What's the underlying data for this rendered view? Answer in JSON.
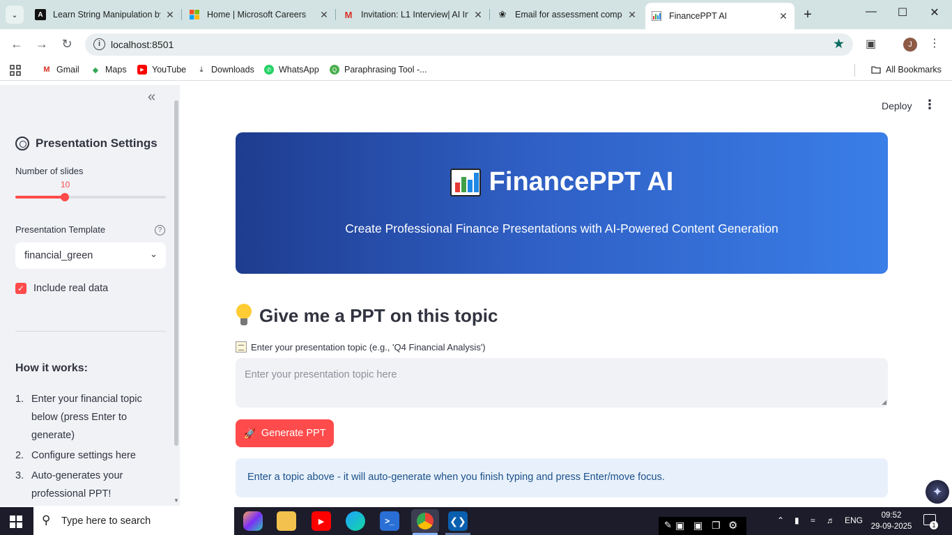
{
  "browser": {
    "tabs": [
      {
        "title": "Learn String Manipulation by",
        "icon": "a-logo-icon"
      },
      {
        "title": "Home | Microsoft Careers",
        "icon": "microsoft-logo-icon"
      },
      {
        "title": "Invitation: L1 Interview| AI In",
        "icon": "gmail-icon"
      },
      {
        "title": "Email for assessment comple",
        "icon": "openai-icon"
      },
      {
        "title": "FinancePPT AI",
        "icon": "bar-chart-icon",
        "active": true
      }
    ],
    "url": "localhost:8501",
    "profile_initial": "J",
    "bookmarks": [
      {
        "label": "Gmail",
        "icon": "gmail-icon"
      },
      {
        "label": "Maps",
        "icon": "maps-icon"
      },
      {
        "label": "YouTube",
        "icon": "youtube-icon"
      },
      {
        "label": "Downloads",
        "icon": "download-icon"
      },
      {
        "label": "WhatsApp",
        "icon": "whatsapp-icon"
      },
      {
        "label": "Paraphrasing Tool -...",
        "icon": "quillbot-icon"
      }
    ],
    "all_bookmarks": "All Bookmarks"
  },
  "sidebar": {
    "heading": "Presentation Settings",
    "slides_label": "Number of slides",
    "slides_value": "10",
    "slides_fraction": 0.33,
    "template_label": "Presentation Template",
    "template_value": "financial_green",
    "include_data_label": "Include real data",
    "include_data_checked": true,
    "how_title": "How it works:",
    "steps": [
      {
        "num": "1.",
        "text": "Enter your financial topic below (press Enter to generate)"
      },
      {
        "num": "2.",
        "text": "Configure settings here"
      },
      {
        "num": "3.",
        "text": "Auto-generates your professional PPT!"
      }
    ]
  },
  "main": {
    "deploy_label": "Deploy",
    "hero_title": "FinancePPT AI",
    "hero_subtitle": "Create Professional Finance Presentations with AI-Powered Content Generation",
    "topic_heading": "Give me a PPT on this topic",
    "topic_label": "Enter your presentation topic (e.g., 'Q4 Financial Analysis')",
    "topic_placeholder": "Enter your presentation topic here",
    "generate_label": "Generate PPT",
    "info_text": "Enter a topic above - it will auto-generate when you finish typing and press Enter/move focus."
  },
  "taskbar": {
    "search_placeholder": "Type here to search",
    "language": "ENG",
    "time": "09:52",
    "date": "29-09-2025",
    "notifications": "1"
  },
  "colors": {
    "accent": "#ff4b4b",
    "hero_start": "#1e3c8f",
    "hero_end": "#3a7ee8",
    "info_bg": "#e8f1fb",
    "info_text": "#1c4f89"
  }
}
